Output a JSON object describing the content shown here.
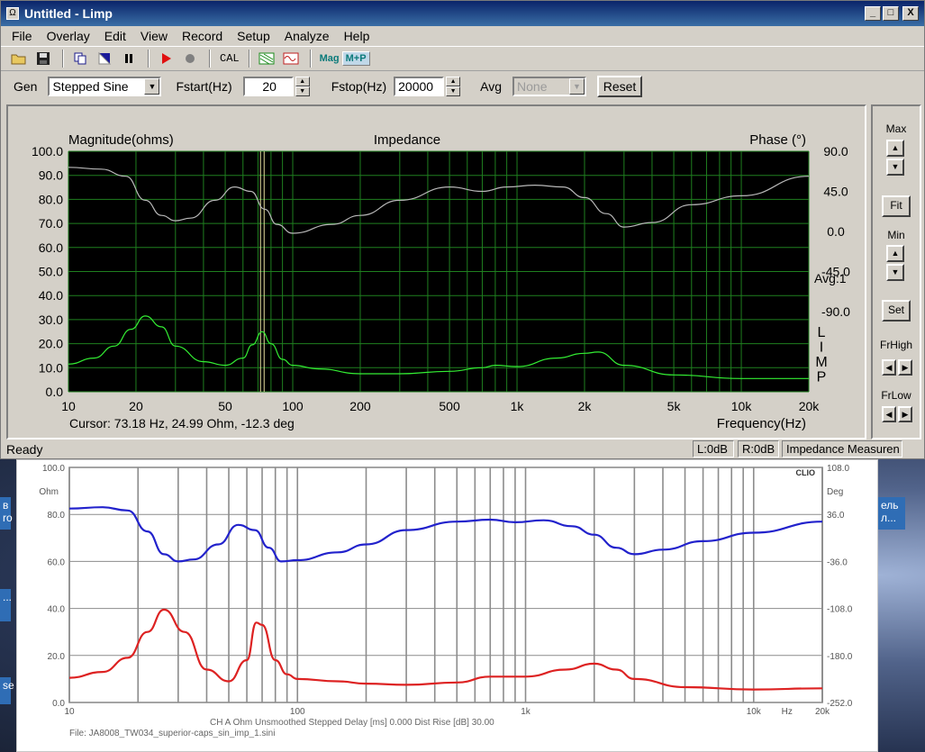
{
  "window": {
    "title": "Untitled - Limp",
    "buttons": [
      "_",
      "□",
      "X"
    ]
  },
  "menu": [
    "File",
    "Overlay",
    "Edit",
    "View",
    "Record",
    "Setup",
    "Analyze",
    "Help"
  ],
  "toolbar": {
    "cal": "CAL",
    "mag": "Mag",
    "mp": "M+P"
  },
  "gen": {
    "gen_label": "Gen",
    "gen_value": "Stepped Sine",
    "fstart_label": "Fstart(Hz)",
    "fstart_value": "20",
    "fstop_label": "Fstop(Hz)",
    "fstop_value": "20000",
    "avg_label": "Avg",
    "avg_value": "None",
    "reset_label": "Reset"
  },
  "side": {
    "max": "Max",
    "fit": "Fit",
    "min": "Min",
    "set": "Set",
    "frhigh": "FrHigh",
    "frlow": "FrLow"
  },
  "status": {
    "ready": "Ready",
    "left": "L:0dB",
    "right": "R:0dB",
    "mode": "Impedance Measuren"
  },
  "desktop": {
    "tab1": "в",
    "tab1b": "ro",
    "tab2": "...",
    "tab3": "se",
    "tab4": "ель",
    "tab4b": "л..."
  },
  "chart_data": [
    {
      "type": "line",
      "title": "Impedance",
      "ylabel": "Magnitude(ohms)",
      "y2label": "Phase (°)",
      "xlabel": "Frequency(Hz)",
      "xscale": "log",
      "xlim": [
        10,
        20000
      ],
      "ylim": [
        0,
        100
      ],
      "y2lim": [
        -180,
        90
      ],
      "xticks": [
        "10",
        "20",
        "50",
        "100",
        "200",
        "500",
        "1k",
        "2k",
        "5k",
        "10k",
        "20k"
      ],
      "xtick_values": [
        10,
        20,
        50,
        100,
        200,
        500,
        1000,
        2000,
        5000,
        10000,
        20000
      ],
      "yticks": [
        "100.0",
        "90.0",
        "80.0",
        "70.0",
        "60.0",
        "50.0",
        "40.0",
        "30.0",
        "20.0",
        "10.0",
        "0.0"
      ],
      "y2ticks": [
        "90.0",
        "45.0",
        "0.0",
        "-45.0",
        "-90.0"
      ],
      "avg": "Avg:1",
      "side_letters": [
        "L",
        "I",
        "M",
        "P"
      ],
      "cursor_text": "Cursor: 73.18 Hz, 24.99 Ohm, -12.3 deg",
      "cursor_x": 73.18,
      "grid": true,
      "background": "#000000",
      "grid_color": "#1f7f1f",
      "series": [
        {
          "name": "Magnitude",
          "axis": "left",
          "color": "#33ee33",
          "x": [
            10,
            13,
            16,
            19,
            22,
            26,
            30,
            40,
            50,
            60,
            66,
            73,
            80,
            90,
            100,
            130,
            200,
            300,
            500,
            700,
            800,
            1000,
            1500,
            2000,
            2300,
            3000,
            5000,
            10000,
            20000
          ],
          "y": [
            11.5,
            14,
            19,
            26,
            31.5,
            27,
            19,
            12.5,
            11,
            14,
            19.5,
            25,
            20,
            13.5,
            11,
            9.5,
            7.5,
            7.5,
            8.5,
            10,
            11,
            10.5,
            14,
            16,
            16.5,
            11,
            7,
            5.5,
            5.5
          ]
        },
        {
          "name": "Phase",
          "axis": "right",
          "color": "#b8b8b8",
          "x": [
            10,
            14,
            18,
            22,
            26,
            30,
            35,
            45,
            55,
            65,
            75,
            85,
            100,
            150,
            200,
            300,
            500,
            700,
            900,
            1200,
            1600,
            2000,
            2500,
            3000,
            4000,
            6000,
            10000,
            20000
          ],
          "y": [
            72,
            70,
            62,
            35,
            18,
            12,
            15,
            35,
            50,
            45,
            25,
            8,
            -2,
            8,
            18,
            35,
            50,
            45,
            50,
            52,
            50,
            38,
            20,
            5,
            10,
            30,
            40,
            62
          ]
        }
      ]
    },
    {
      "type": "line",
      "title": "",
      "ylabel": "Ohm",
      "y2label": "Deg",
      "xscale": "log",
      "xlim": [
        10,
        20000
      ],
      "ylim": [
        0,
        100
      ],
      "y2lim": [
        -252,
        108
      ],
      "yticks": [
        "100.0",
        "80.0",
        "60.0",
        "40.0",
        "20.0",
        "0.0"
      ],
      "y2ticks": [
        "108.0",
        "36.0",
        "-36.0",
        "-108.0",
        "-180.0",
        "-252.0"
      ],
      "xticks": [
        "10",
        "100",
        "1k",
        "10k",
        "Hz",
        "20k"
      ],
      "logo": "CLIO",
      "footer1": "CH A   Ohm   Unsmoothed   Stepped   Delay [ms] 0.000   Dist Rise [dB] 30.00",
      "footer2": "File: JA8008_TW034_superior-caps_sin_imp_1.sini",
      "series": [
        {
          "name": "Ohm",
          "axis": "left",
          "color": "#dd2222",
          "x": [
            10,
            14,
            18,
            22,
            26,
            32,
            40,
            50,
            60,
            66,
            70,
            80,
            90,
            100,
            150,
            200,
            300,
            500,
            700,
            1000,
            1500,
            2000,
            2500,
            3000,
            5000,
            10000,
            20000
          ],
          "y": [
            10.5,
            13,
            19,
            30,
            39.5,
            30,
            14,
            9,
            18,
            34,
            33,
            18,
            12,
            10,
            9,
            8,
            7.5,
            8.5,
            11,
            11,
            14,
            16.5,
            14,
            10,
            6.5,
            5.5,
            6
          ]
        },
        {
          "name": "Deg",
          "axis": "right",
          "color": "#2222cc",
          "x": [
            10,
            14,
            18,
            22,
            26,
            30,
            35,
            45,
            55,
            65,
            75,
            85,
            100,
            150,
            200,
            300,
            500,
            700,
            900,
            1200,
            1600,
            2000,
            2500,
            3000,
            4000,
            6000,
            10000,
            20000
          ],
          "y": [
            45,
            47,
            42,
            10,
            -25,
            -36,
            -33,
            -10,
            20,
            12,
            -15,
            -36,
            -34,
            -22,
            -10,
            12,
            25,
            28,
            24,
            27,
            18,
            5,
            -15,
            -25,
            -18,
            -5,
            8,
            25
          ]
        }
      ]
    }
  ]
}
